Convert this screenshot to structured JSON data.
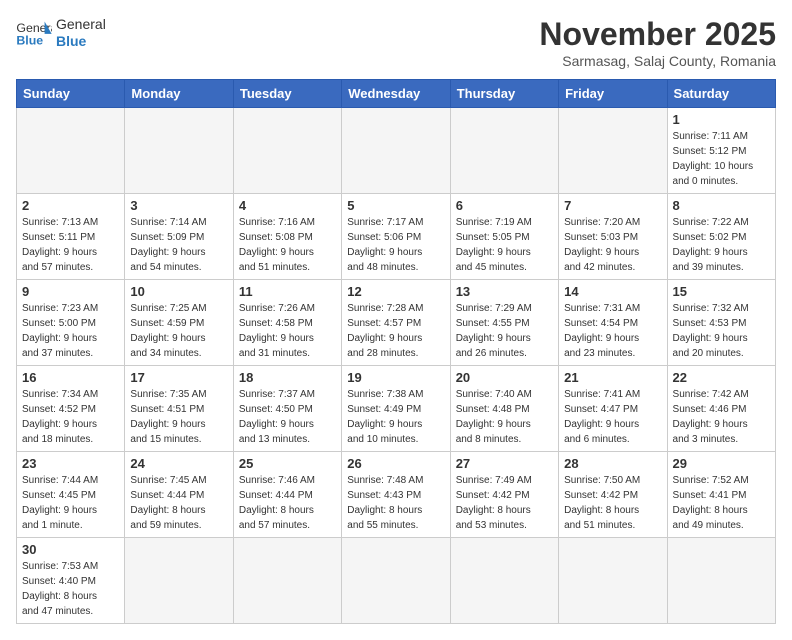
{
  "header": {
    "logo_general": "General",
    "logo_blue": "Blue",
    "title": "November 2025",
    "subtitle": "Sarmasag, Salaj County, Romania"
  },
  "days_of_week": [
    "Sunday",
    "Monday",
    "Tuesday",
    "Wednesday",
    "Thursday",
    "Friday",
    "Saturday"
  ],
  "weeks": [
    [
      {
        "day": "",
        "info": ""
      },
      {
        "day": "",
        "info": ""
      },
      {
        "day": "",
        "info": ""
      },
      {
        "day": "",
        "info": ""
      },
      {
        "day": "",
        "info": ""
      },
      {
        "day": "",
        "info": ""
      },
      {
        "day": "1",
        "info": "Sunrise: 7:11 AM\nSunset: 5:12 PM\nDaylight: 10 hours\nand 0 minutes."
      }
    ],
    [
      {
        "day": "2",
        "info": "Sunrise: 7:13 AM\nSunset: 5:11 PM\nDaylight: 9 hours\nand 57 minutes."
      },
      {
        "day": "3",
        "info": "Sunrise: 7:14 AM\nSunset: 5:09 PM\nDaylight: 9 hours\nand 54 minutes."
      },
      {
        "day": "4",
        "info": "Sunrise: 7:16 AM\nSunset: 5:08 PM\nDaylight: 9 hours\nand 51 minutes."
      },
      {
        "day": "5",
        "info": "Sunrise: 7:17 AM\nSunset: 5:06 PM\nDaylight: 9 hours\nand 48 minutes."
      },
      {
        "day": "6",
        "info": "Sunrise: 7:19 AM\nSunset: 5:05 PM\nDaylight: 9 hours\nand 45 minutes."
      },
      {
        "day": "7",
        "info": "Sunrise: 7:20 AM\nSunset: 5:03 PM\nDaylight: 9 hours\nand 42 minutes."
      },
      {
        "day": "8",
        "info": "Sunrise: 7:22 AM\nSunset: 5:02 PM\nDaylight: 9 hours\nand 39 minutes."
      }
    ],
    [
      {
        "day": "9",
        "info": "Sunrise: 7:23 AM\nSunset: 5:00 PM\nDaylight: 9 hours\nand 37 minutes."
      },
      {
        "day": "10",
        "info": "Sunrise: 7:25 AM\nSunset: 4:59 PM\nDaylight: 9 hours\nand 34 minutes."
      },
      {
        "day": "11",
        "info": "Sunrise: 7:26 AM\nSunset: 4:58 PM\nDaylight: 9 hours\nand 31 minutes."
      },
      {
        "day": "12",
        "info": "Sunrise: 7:28 AM\nSunset: 4:57 PM\nDaylight: 9 hours\nand 28 minutes."
      },
      {
        "day": "13",
        "info": "Sunrise: 7:29 AM\nSunset: 4:55 PM\nDaylight: 9 hours\nand 26 minutes."
      },
      {
        "day": "14",
        "info": "Sunrise: 7:31 AM\nSunset: 4:54 PM\nDaylight: 9 hours\nand 23 minutes."
      },
      {
        "day": "15",
        "info": "Sunrise: 7:32 AM\nSunset: 4:53 PM\nDaylight: 9 hours\nand 20 minutes."
      }
    ],
    [
      {
        "day": "16",
        "info": "Sunrise: 7:34 AM\nSunset: 4:52 PM\nDaylight: 9 hours\nand 18 minutes."
      },
      {
        "day": "17",
        "info": "Sunrise: 7:35 AM\nSunset: 4:51 PM\nDaylight: 9 hours\nand 15 minutes."
      },
      {
        "day": "18",
        "info": "Sunrise: 7:37 AM\nSunset: 4:50 PM\nDaylight: 9 hours\nand 13 minutes."
      },
      {
        "day": "19",
        "info": "Sunrise: 7:38 AM\nSunset: 4:49 PM\nDaylight: 9 hours\nand 10 minutes."
      },
      {
        "day": "20",
        "info": "Sunrise: 7:40 AM\nSunset: 4:48 PM\nDaylight: 9 hours\nand 8 minutes."
      },
      {
        "day": "21",
        "info": "Sunrise: 7:41 AM\nSunset: 4:47 PM\nDaylight: 9 hours\nand 6 minutes."
      },
      {
        "day": "22",
        "info": "Sunrise: 7:42 AM\nSunset: 4:46 PM\nDaylight: 9 hours\nand 3 minutes."
      }
    ],
    [
      {
        "day": "23",
        "info": "Sunrise: 7:44 AM\nSunset: 4:45 PM\nDaylight: 9 hours\nand 1 minute."
      },
      {
        "day": "24",
        "info": "Sunrise: 7:45 AM\nSunset: 4:44 PM\nDaylight: 8 hours\nand 59 minutes."
      },
      {
        "day": "25",
        "info": "Sunrise: 7:46 AM\nSunset: 4:44 PM\nDaylight: 8 hours\nand 57 minutes."
      },
      {
        "day": "26",
        "info": "Sunrise: 7:48 AM\nSunset: 4:43 PM\nDaylight: 8 hours\nand 55 minutes."
      },
      {
        "day": "27",
        "info": "Sunrise: 7:49 AM\nSunset: 4:42 PM\nDaylight: 8 hours\nand 53 minutes."
      },
      {
        "day": "28",
        "info": "Sunrise: 7:50 AM\nSunset: 4:42 PM\nDaylight: 8 hours\nand 51 minutes."
      },
      {
        "day": "29",
        "info": "Sunrise: 7:52 AM\nSunset: 4:41 PM\nDaylight: 8 hours\nand 49 minutes."
      }
    ],
    [
      {
        "day": "30",
        "info": "Sunrise: 7:53 AM\nSunset: 4:40 PM\nDaylight: 8 hours\nand 47 minutes."
      },
      {
        "day": "",
        "info": ""
      },
      {
        "day": "",
        "info": ""
      },
      {
        "day": "",
        "info": ""
      },
      {
        "day": "",
        "info": ""
      },
      {
        "day": "",
        "info": ""
      },
      {
        "day": "",
        "info": ""
      }
    ]
  ]
}
